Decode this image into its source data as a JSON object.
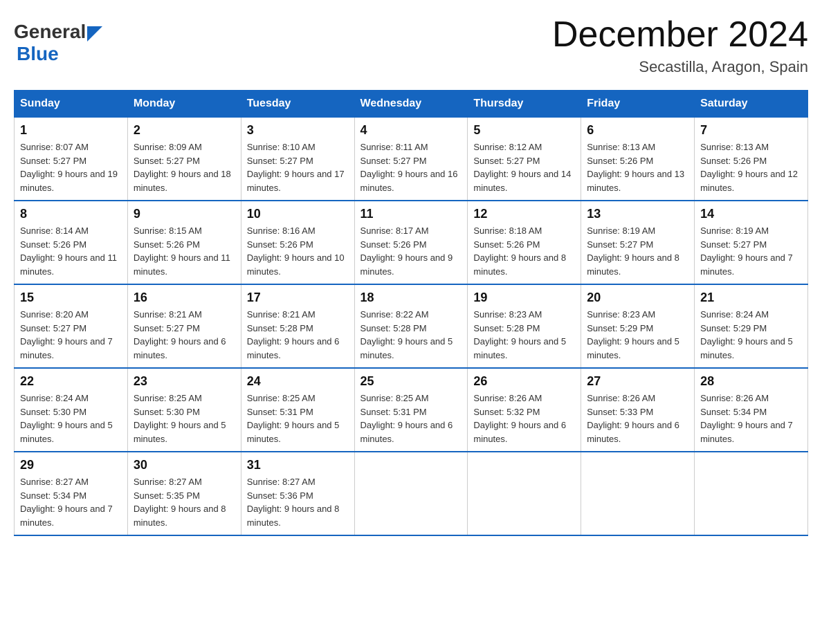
{
  "header": {
    "title": "December 2024",
    "location": "Secastilla, Aragon, Spain",
    "logo_general": "General",
    "logo_blue": "Blue"
  },
  "weekdays": [
    "Sunday",
    "Monday",
    "Tuesday",
    "Wednesday",
    "Thursday",
    "Friday",
    "Saturday"
  ],
  "weeks": [
    [
      {
        "day": "1",
        "sunrise": "8:07 AM",
        "sunset": "5:27 PM",
        "daylight": "9 hours and 19 minutes."
      },
      {
        "day": "2",
        "sunrise": "8:09 AM",
        "sunset": "5:27 PM",
        "daylight": "9 hours and 18 minutes."
      },
      {
        "day": "3",
        "sunrise": "8:10 AM",
        "sunset": "5:27 PM",
        "daylight": "9 hours and 17 minutes."
      },
      {
        "day": "4",
        "sunrise": "8:11 AM",
        "sunset": "5:27 PM",
        "daylight": "9 hours and 16 minutes."
      },
      {
        "day": "5",
        "sunrise": "8:12 AM",
        "sunset": "5:27 PM",
        "daylight": "9 hours and 14 minutes."
      },
      {
        "day": "6",
        "sunrise": "8:13 AM",
        "sunset": "5:26 PM",
        "daylight": "9 hours and 13 minutes."
      },
      {
        "day": "7",
        "sunrise": "8:13 AM",
        "sunset": "5:26 PM",
        "daylight": "9 hours and 12 minutes."
      }
    ],
    [
      {
        "day": "8",
        "sunrise": "8:14 AM",
        "sunset": "5:26 PM",
        "daylight": "9 hours and 11 minutes."
      },
      {
        "day": "9",
        "sunrise": "8:15 AM",
        "sunset": "5:26 PM",
        "daylight": "9 hours and 11 minutes."
      },
      {
        "day": "10",
        "sunrise": "8:16 AM",
        "sunset": "5:26 PM",
        "daylight": "9 hours and 10 minutes."
      },
      {
        "day": "11",
        "sunrise": "8:17 AM",
        "sunset": "5:26 PM",
        "daylight": "9 hours and 9 minutes."
      },
      {
        "day": "12",
        "sunrise": "8:18 AM",
        "sunset": "5:26 PM",
        "daylight": "9 hours and 8 minutes."
      },
      {
        "day": "13",
        "sunrise": "8:19 AM",
        "sunset": "5:27 PM",
        "daylight": "9 hours and 8 minutes."
      },
      {
        "day": "14",
        "sunrise": "8:19 AM",
        "sunset": "5:27 PM",
        "daylight": "9 hours and 7 minutes."
      }
    ],
    [
      {
        "day": "15",
        "sunrise": "8:20 AM",
        "sunset": "5:27 PM",
        "daylight": "9 hours and 7 minutes."
      },
      {
        "day": "16",
        "sunrise": "8:21 AM",
        "sunset": "5:27 PM",
        "daylight": "9 hours and 6 minutes."
      },
      {
        "day": "17",
        "sunrise": "8:21 AM",
        "sunset": "5:28 PM",
        "daylight": "9 hours and 6 minutes."
      },
      {
        "day": "18",
        "sunrise": "8:22 AM",
        "sunset": "5:28 PM",
        "daylight": "9 hours and 5 minutes."
      },
      {
        "day": "19",
        "sunrise": "8:23 AM",
        "sunset": "5:28 PM",
        "daylight": "9 hours and 5 minutes."
      },
      {
        "day": "20",
        "sunrise": "8:23 AM",
        "sunset": "5:29 PM",
        "daylight": "9 hours and 5 minutes."
      },
      {
        "day": "21",
        "sunrise": "8:24 AM",
        "sunset": "5:29 PM",
        "daylight": "9 hours and 5 minutes."
      }
    ],
    [
      {
        "day": "22",
        "sunrise": "8:24 AM",
        "sunset": "5:30 PM",
        "daylight": "9 hours and 5 minutes."
      },
      {
        "day": "23",
        "sunrise": "8:25 AM",
        "sunset": "5:30 PM",
        "daylight": "9 hours and 5 minutes."
      },
      {
        "day": "24",
        "sunrise": "8:25 AM",
        "sunset": "5:31 PM",
        "daylight": "9 hours and 5 minutes."
      },
      {
        "day": "25",
        "sunrise": "8:25 AM",
        "sunset": "5:31 PM",
        "daylight": "9 hours and 6 minutes."
      },
      {
        "day": "26",
        "sunrise": "8:26 AM",
        "sunset": "5:32 PM",
        "daylight": "9 hours and 6 minutes."
      },
      {
        "day": "27",
        "sunrise": "8:26 AM",
        "sunset": "5:33 PM",
        "daylight": "9 hours and 6 minutes."
      },
      {
        "day": "28",
        "sunrise": "8:26 AM",
        "sunset": "5:34 PM",
        "daylight": "9 hours and 7 minutes."
      }
    ],
    [
      {
        "day": "29",
        "sunrise": "8:27 AM",
        "sunset": "5:34 PM",
        "daylight": "9 hours and 7 minutes."
      },
      {
        "day": "30",
        "sunrise": "8:27 AM",
        "sunset": "5:35 PM",
        "daylight": "9 hours and 8 minutes."
      },
      {
        "day": "31",
        "sunrise": "8:27 AM",
        "sunset": "5:36 PM",
        "daylight": "9 hours and 8 minutes."
      },
      null,
      null,
      null,
      null
    ]
  ]
}
